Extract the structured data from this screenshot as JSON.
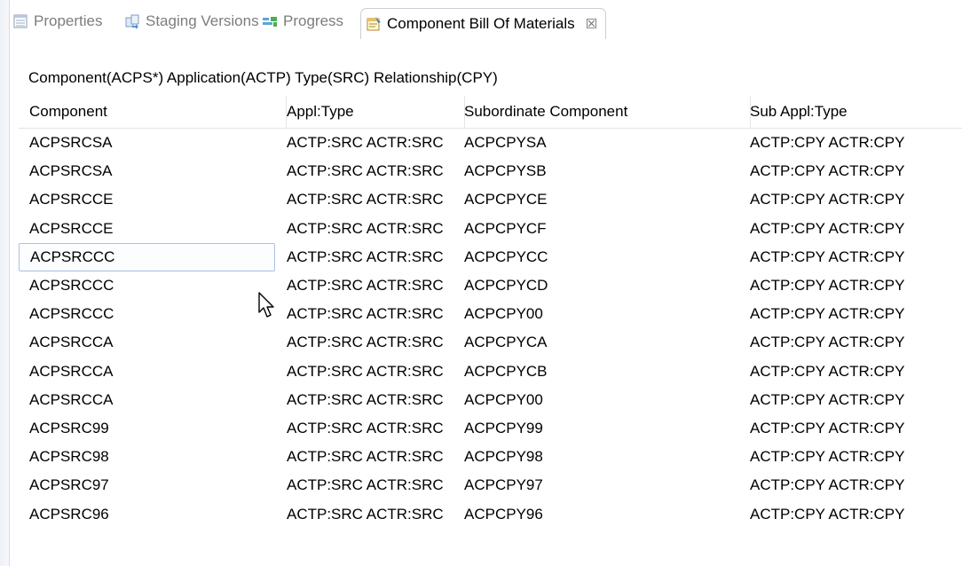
{
  "tabs": [
    {
      "label": "Properties",
      "icon": "properties-icon",
      "active": false
    },
    {
      "label": "Staging Versions",
      "icon": "staging-versions-icon",
      "active": false
    },
    {
      "label": "Progress",
      "icon": "progress-icon",
      "active": false
    },
    {
      "label": "Component Bill Of Materials",
      "icon": "bill-of-materials-icon",
      "active": true
    }
  ],
  "close_glyph": "☒",
  "query": "Component(ACPS*) Application(ACTP) Type(SRC) Relationship(CPY)",
  "columns": [
    "Component",
    "Appl:Type",
    "Subordinate Component",
    "Sub Appl:Type"
  ],
  "rows": [
    [
      "ACPSRCSA",
      "ACTP:SRC ACTR:SRC",
      "ACPCPYSA",
      "ACTP:CPY ACTR:CPY"
    ],
    [
      "ACPSRCSA",
      "ACTP:SRC ACTR:SRC",
      "ACPCPYSB",
      "ACTP:CPY ACTR:CPY"
    ],
    [
      "ACPSRCCE",
      "ACTP:SRC ACTR:SRC",
      "ACPCPYCE",
      "ACTP:CPY ACTR:CPY"
    ],
    [
      "ACPSRCCE",
      "ACTP:SRC ACTR:SRC",
      "ACPCPYCF",
      "ACTP:CPY ACTR:CPY"
    ],
    [
      "ACPSRCCC",
      "ACTP:SRC ACTR:SRC",
      "ACPCPYCC",
      "ACTP:CPY ACTR:CPY"
    ],
    [
      "ACPSRCCC",
      "ACTP:SRC ACTR:SRC",
      "ACPCPYCD",
      "ACTP:CPY ACTR:CPY"
    ],
    [
      "ACPSRCCC",
      "ACTP:SRC ACTR:SRC",
      "ACPCPY00",
      "ACTP:CPY ACTR:CPY"
    ],
    [
      "ACPSRCCA",
      "ACTP:SRC ACTR:SRC",
      "ACPCPYCA",
      "ACTP:CPY ACTR:CPY"
    ],
    [
      "ACPSRCCA",
      "ACTP:SRC ACTR:SRC",
      "ACPCPYCB",
      "ACTP:CPY ACTR:CPY"
    ],
    [
      "ACPSRCCA",
      "ACTP:SRC ACTR:SRC",
      "ACPCPY00",
      "ACTP:CPY ACTR:CPY"
    ],
    [
      "ACPSRC99",
      "ACTP:SRC ACTR:SRC",
      "ACPCPY99",
      "ACTP:CPY ACTR:CPY"
    ],
    [
      "ACPSRC98",
      "ACTP:SRC ACTR:SRC",
      "ACPCPY98",
      "ACTP:CPY ACTR:CPY"
    ],
    [
      "ACPSRC97",
      "ACTP:SRC ACTR:SRC",
      "ACPCPY97",
      "ACTP:CPY ACTR:CPY"
    ],
    [
      "ACPSRC96",
      "ACTP:SRC ACTR:SRC",
      "ACPCPY96",
      "ACTP:CPY ACTR:CPY"
    ]
  ],
  "selected_row": 4,
  "colors": {
    "selection_border": "#a9c0e4",
    "tab_border": "#c9cdd5",
    "inactive_tab_text": "#7d7d7d"
  }
}
